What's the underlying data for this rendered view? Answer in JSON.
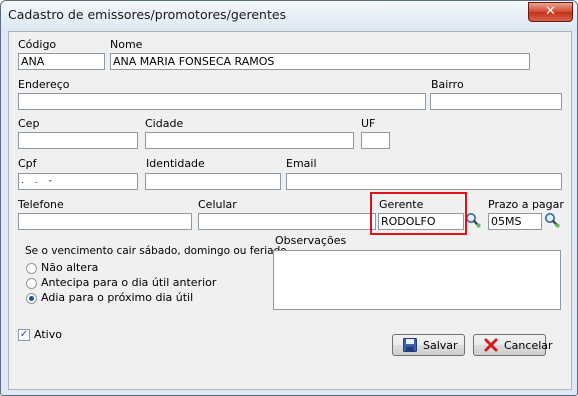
{
  "window": {
    "title": "Cadastro de emissores/promotores/gerentes",
    "close": "✕"
  },
  "fields": {
    "codigo": {
      "label": "Código",
      "value": "ANA"
    },
    "nome": {
      "label": "Nome",
      "value": "ANA MARIA FONSECA RAMOS"
    },
    "endereco": {
      "label": "Endereço",
      "value": ""
    },
    "bairro": {
      "label": "Bairro",
      "value": ""
    },
    "cep": {
      "label": "Cep",
      "value": ""
    },
    "cidade": {
      "label": "Cidade",
      "value": ""
    },
    "uf": {
      "label": "UF",
      "value": ""
    },
    "cpf": {
      "label": "Cpf",
      "value": ". . -"
    },
    "identidade": {
      "label": "Identidade",
      "value": ""
    },
    "email": {
      "label": "Email",
      "value": ""
    },
    "telefone": {
      "label": "Telefone",
      "value": ""
    },
    "celular": {
      "label": "Celular",
      "value": ""
    },
    "gerente": {
      "label": "Gerente",
      "value": "RODOLFO"
    },
    "prazo": {
      "label": "Prazo a pagar",
      "value": "05MS"
    },
    "observacoes": {
      "label": "Observações",
      "value": ""
    }
  },
  "vencimento": {
    "title": "Se o vencimento cair sábado, domingo ou feriado",
    "options": [
      {
        "label": "Não altera",
        "checked": false
      },
      {
        "label": "Antecipa para o dia útil anterior",
        "checked": false
      },
      {
        "label": "Adia para o próximo dia útil",
        "checked": true
      }
    ]
  },
  "ativo": {
    "label": "Ativo",
    "checked": true
  },
  "buttons": {
    "salvar": "Salvar",
    "cancelar": "Cancelar"
  },
  "colors": {
    "highlight": "#d9141b",
    "save_icon": "#3a64b0",
    "cancel_icon": "#d21a1a",
    "lens": "#2c6aa8"
  }
}
